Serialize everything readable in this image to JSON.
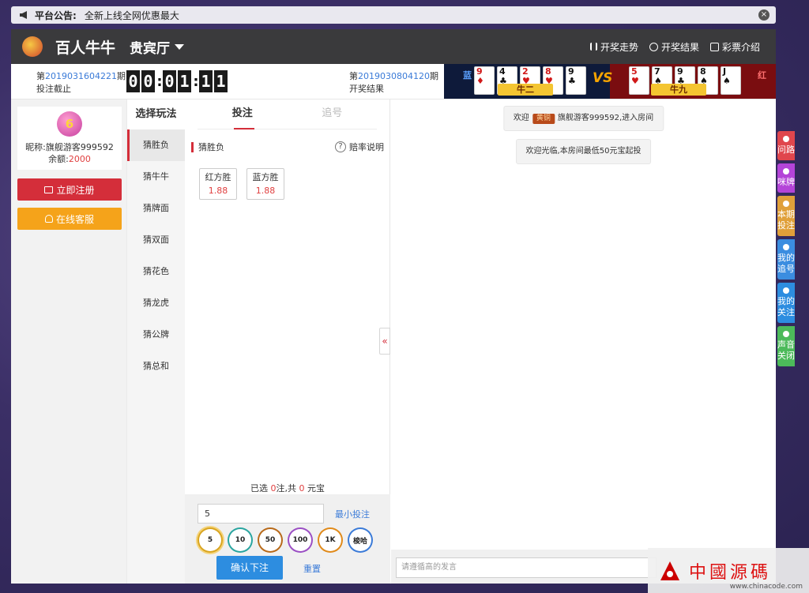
{
  "notice": {
    "label": "平台公告:",
    "text": "全新上线全网优惠最大",
    "close": "×"
  },
  "header": {
    "game_title": "百人牛牛",
    "room": "贵宾厅",
    "links": [
      {
        "label": "开奖走势",
        "icon": "chart-bars-icon"
      },
      {
        "label": "开奖结果",
        "icon": "clock-icon"
      },
      {
        "label": "彩票介绍",
        "icon": "document-icon"
      }
    ]
  },
  "status": {
    "current_prefix": "第",
    "current_period": "2019031604221",
    "current_suffix": "期",
    "current_status": "投注截止",
    "timer": [
      "0",
      "0",
      "0",
      "1",
      "1",
      "1"
    ],
    "prev_prefix": "第",
    "prev_period": "2019030804120",
    "prev_suffix": "期",
    "prev_status": "开奖结果"
  },
  "result": {
    "blue_label": "蓝",
    "red_label": "红",
    "vs": "VS",
    "blue_cards": [
      {
        "rank": "9",
        "suit": "♦",
        "color": "r"
      },
      {
        "rank": "4",
        "suit": "♣",
        "color": "b"
      },
      {
        "rank": "2",
        "suit": "♥",
        "color": "r"
      },
      {
        "rank": "8",
        "suit": "♥",
        "color": "r"
      },
      {
        "rank": "9",
        "suit": "♣",
        "color": "b"
      }
    ],
    "red_cards": [
      {
        "rank": "5",
        "suit": "♥",
        "color": "r"
      },
      {
        "rank": "7",
        "suit": "♠",
        "color": "b"
      },
      {
        "rank": "9",
        "suit": "♣",
        "color": "b"
      },
      {
        "rank": "8",
        "suit": "♠",
        "color": "b"
      },
      {
        "rank": "J",
        "suit": "♠",
        "color": "b"
      }
    ],
    "blue_hand": "牛二",
    "red_hand": "牛九"
  },
  "profile": {
    "level": "6",
    "nick_label": "昵称:",
    "nick": "旗舰游客999592",
    "balance_label": "余额:",
    "balance": "2000"
  },
  "buttons": {
    "register": "立即注册",
    "service": "在线客服"
  },
  "play": {
    "header": "选择玩法",
    "items": [
      "猜胜负",
      "猜牛牛",
      "猜牌面",
      "猜双面",
      "猜花色",
      "猜龙虎",
      "猜公牌",
      "猜总和"
    ]
  },
  "bet": {
    "tabs": [
      "投注",
      "追号"
    ],
    "sub_title": "猜胜负",
    "odds_help": "赔率说明",
    "options": [
      {
        "label": "红方胜",
        "odds": "1.88"
      },
      {
        "label": "蓝方胜",
        "odds": "1.88"
      }
    ],
    "summary_prefix": "已选",
    "summary_count": "0",
    "summary_mid": "注,共",
    "summary_amount": "0",
    "summary_suffix": "元宝",
    "amount_value": "5",
    "min_bet": "最小投注",
    "chips": [
      {
        "label": "5",
        "color": "#d9a520"
      },
      {
        "label": "10",
        "color": "#2aa5a0"
      },
      {
        "label": "50",
        "color": "#b86a1a"
      },
      {
        "label": "100",
        "color": "#9b4fc4"
      },
      {
        "label": "1K",
        "color": "#e08a1a"
      },
      {
        "label": "梭哈",
        "color": "#3b7bd8"
      }
    ],
    "confirm": "确认下注",
    "reset": "重置"
  },
  "chat": {
    "welcome_prefix": "欢迎",
    "vip_badge": "黄铜",
    "welcome_user": "旗舰游客999592,进入房间",
    "room_msg": "欢迎光临,本房间最低50元宝起投",
    "input_placeholder": "请遵循高的发言"
  },
  "side_tabs": [
    {
      "label": "问路",
      "color": "#e0464d"
    },
    {
      "label": "咪牌",
      "color": "#b444d8"
    },
    {
      "label": "本期投注",
      "color": "#e0a03a"
    },
    {
      "label": "我的追号",
      "color": "#3b8de0"
    },
    {
      "label": "我的关注",
      "color": "#2d8de0"
    },
    {
      "label": "声音关闭",
      "color": "#4cba5a"
    }
  ],
  "watermark": {
    "text": "中國源碼",
    "url": "www.chinacode.com"
  }
}
